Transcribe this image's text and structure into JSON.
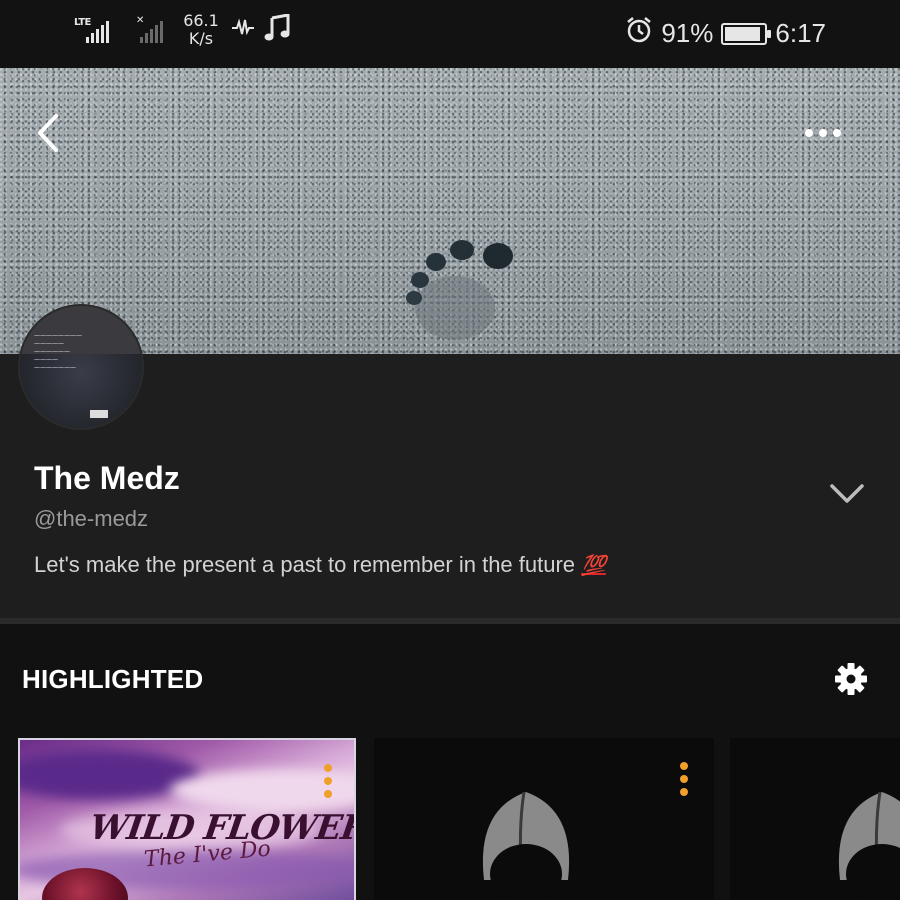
{
  "status_bar": {
    "network_type": "LTE",
    "data_speed_value": "66.1",
    "data_speed_unit": "K/s",
    "battery_percent": "91%",
    "battery_level": 0.91,
    "time": "6:17",
    "icons": [
      "signal-lte-icon",
      "signal-no-service-icon",
      "audio-wave-icon",
      "music-note-icon",
      "alarm-icon",
      "battery-icon"
    ]
  },
  "header": {
    "back_icon": "chevron-left-icon",
    "more_icon": "more-horizontal-icon"
  },
  "profile": {
    "name": "The Medz",
    "handle": "@the-medz",
    "bio": "Let's make the present a past to remember in the future",
    "bio_emoji": "💯",
    "expand_icon": "chevron-down-icon"
  },
  "highlighted": {
    "title": "HIGHLIGHTED",
    "settings_icon": "gear-icon",
    "cards": [
      {
        "title": "WILD FLOWER",
        "subtitle": "The I've Do"
      },
      {
        "title": ""
      },
      {
        "title": ""
      }
    ]
  },
  "colors": {
    "background": "#111111",
    "profile_background": "#1e1e1e",
    "status_bar": "#121212",
    "menu_dots": "#f0a02a",
    "bio_emoji": "#e0242c"
  }
}
